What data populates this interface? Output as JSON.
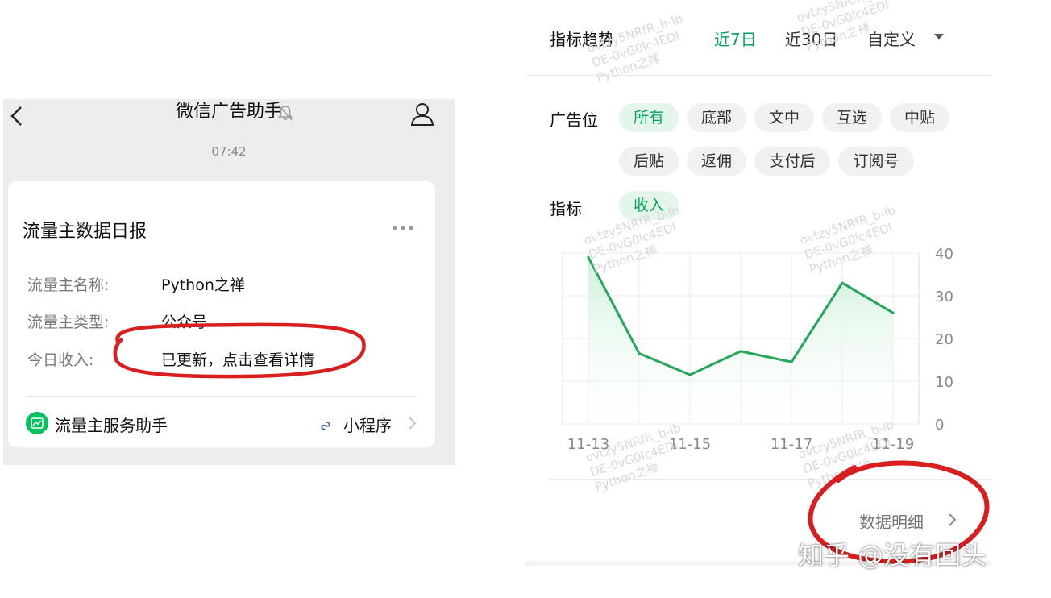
{
  "chat": {
    "title": "微信广告助手",
    "time": "07:42",
    "card": {
      "title": "流量主数据日报",
      "rows": [
        {
          "label": "流量主名称:",
          "value": "Python之禅"
        },
        {
          "label": "流量主类型:",
          "value": "公众号"
        },
        {
          "label": "今日收入:",
          "value": "已更新，点击查看详情"
        }
      ],
      "source": "流量主服务助手",
      "miniprogram": "小程序"
    }
  },
  "trend": {
    "title": "指标趋势",
    "ranges": [
      {
        "label": "近7日",
        "active": true
      },
      {
        "label": "近30日",
        "active": false
      },
      {
        "label": "自定义",
        "active": false
      }
    ],
    "ad_slot_label": "广告位",
    "ad_slots": [
      {
        "label": "所有",
        "active": true
      },
      {
        "label": "底部",
        "active": false
      },
      {
        "label": "文中",
        "active": false
      },
      {
        "label": "互选",
        "active": false
      },
      {
        "label": "中贴",
        "active": false
      },
      {
        "label": "后贴",
        "active": false
      },
      {
        "label": "返佣",
        "active": false
      },
      {
        "label": "支付后",
        "active": false
      },
      {
        "label": "订阅号",
        "active": false
      }
    ],
    "metric_label": "指标",
    "metric": "收入",
    "detail_link": "数据明细"
  },
  "chart_data": {
    "type": "area",
    "x": [
      "11-13",
      "11-14",
      "11-15",
      "11-16",
      "11-17",
      "11-18",
      "11-19"
    ],
    "x_tick_labels": [
      "11-13",
      "11-15",
      "11-17",
      "11-19"
    ],
    "series": [
      {
        "values": [
          39,
          16.5,
          11.5,
          17,
          14.5,
          33,
          26
        ]
      }
    ],
    "ylim": [
      0,
      40
    ],
    "y_ticks": [
      0,
      10,
      20,
      30,
      40
    ],
    "y_axis_position": "right",
    "grid": true,
    "colors": {
      "line": "#26a65b",
      "fill": "#d6f2df"
    }
  },
  "watermark": {
    "lines": [
      "ovtzy5NRfR_b-lb",
      "DE-0vG0lc4EDI",
      "Python之禅"
    ]
  },
  "credit": "知乎 @没有回头",
  "colors": {
    "accent": "#07a35a",
    "annotation": "#d81e1e"
  }
}
